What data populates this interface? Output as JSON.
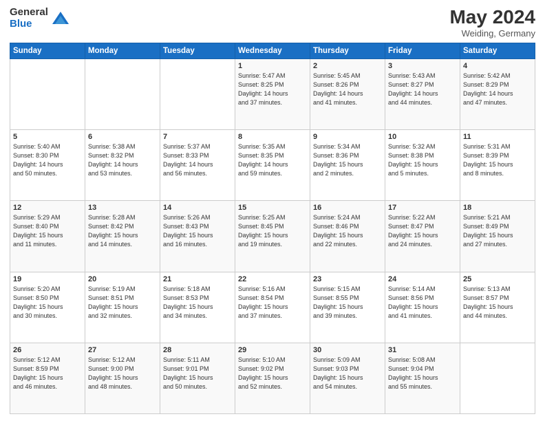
{
  "header": {
    "logo_general": "General",
    "logo_blue": "Blue",
    "month_year": "May 2024",
    "location": "Weiding, Germany"
  },
  "weekdays": [
    "Sunday",
    "Monday",
    "Tuesday",
    "Wednesday",
    "Thursday",
    "Friday",
    "Saturday"
  ],
  "weeks": [
    [
      {
        "day": "",
        "info": ""
      },
      {
        "day": "",
        "info": ""
      },
      {
        "day": "",
        "info": ""
      },
      {
        "day": "1",
        "info": "Sunrise: 5:47 AM\nSunset: 8:25 PM\nDaylight: 14 hours\nand 37 minutes."
      },
      {
        "day": "2",
        "info": "Sunrise: 5:45 AM\nSunset: 8:26 PM\nDaylight: 14 hours\nand 41 minutes."
      },
      {
        "day": "3",
        "info": "Sunrise: 5:43 AM\nSunset: 8:27 PM\nDaylight: 14 hours\nand 44 minutes."
      },
      {
        "day": "4",
        "info": "Sunrise: 5:42 AM\nSunset: 8:29 PM\nDaylight: 14 hours\nand 47 minutes."
      }
    ],
    [
      {
        "day": "5",
        "info": "Sunrise: 5:40 AM\nSunset: 8:30 PM\nDaylight: 14 hours\nand 50 minutes."
      },
      {
        "day": "6",
        "info": "Sunrise: 5:38 AM\nSunset: 8:32 PM\nDaylight: 14 hours\nand 53 minutes."
      },
      {
        "day": "7",
        "info": "Sunrise: 5:37 AM\nSunset: 8:33 PM\nDaylight: 14 hours\nand 56 minutes."
      },
      {
        "day": "8",
        "info": "Sunrise: 5:35 AM\nSunset: 8:35 PM\nDaylight: 14 hours\nand 59 minutes."
      },
      {
        "day": "9",
        "info": "Sunrise: 5:34 AM\nSunset: 8:36 PM\nDaylight: 15 hours\nand 2 minutes."
      },
      {
        "day": "10",
        "info": "Sunrise: 5:32 AM\nSunset: 8:38 PM\nDaylight: 15 hours\nand 5 minutes."
      },
      {
        "day": "11",
        "info": "Sunrise: 5:31 AM\nSunset: 8:39 PM\nDaylight: 15 hours\nand 8 minutes."
      }
    ],
    [
      {
        "day": "12",
        "info": "Sunrise: 5:29 AM\nSunset: 8:40 PM\nDaylight: 15 hours\nand 11 minutes."
      },
      {
        "day": "13",
        "info": "Sunrise: 5:28 AM\nSunset: 8:42 PM\nDaylight: 15 hours\nand 14 minutes."
      },
      {
        "day": "14",
        "info": "Sunrise: 5:26 AM\nSunset: 8:43 PM\nDaylight: 15 hours\nand 16 minutes."
      },
      {
        "day": "15",
        "info": "Sunrise: 5:25 AM\nSunset: 8:45 PM\nDaylight: 15 hours\nand 19 minutes."
      },
      {
        "day": "16",
        "info": "Sunrise: 5:24 AM\nSunset: 8:46 PM\nDaylight: 15 hours\nand 22 minutes."
      },
      {
        "day": "17",
        "info": "Sunrise: 5:22 AM\nSunset: 8:47 PM\nDaylight: 15 hours\nand 24 minutes."
      },
      {
        "day": "18",
        "info": "Sunrise: 5:21 AM\nSunset: 8:49 PM\nDaylight: 15 hours\nand 27 minutes."
      }
    ],
    [
      {
        "day": "19",
        "info": "Sunrise: 5:20 AM\nSunset: 8:50 PM\nDaylight: 15 hours\nand 30 minutes."
      },
      {
        "day": "20",
        "info": "Sunrise: 5:19 AM\nSunset: 8:51 PM\nDaylight: 15 hours\nand 32 minutes."
      },
      {
        "day": "21",
        "info": "Sunrise: 5:18 AM\nSunset: 8:53 PM\nDaylight: 15 hours\nand 34 minutes."
      },
      {
        "day": "22",
        "info": "Sunrise: 5:16 AM\nSunset: 8:54 PM\nDaylight: 15 hours\nand 37 minutes."
      },
      {
        "day": "23",
        "info": "Sunrise: 5:15 AM\nSunset: 8:55 PM\nDaylight: 15 hours\nand 39 minutes."
      },
      {
        "day": "24",
        "info": "Sunrise: 5:14 AM\nSunset: 8:56 PM\nDaylight: 15 hours\nand 41 minutes."
      },
      {
        "day": "25",
        "info": "Sunrise: 5:13 AM\nSunset: 8:57 PM\nDaylight: 15 hours\nand 44 minutes."
      }
    ],
    [
      {
        "day": "26",
        "info": "Sunrise: 5:12 AM\nSunset: 8:59 PM\nDaylight: 15 hours\nand 46 minutes."
      },
      {
        "day": "27",
        "info": "Sunrise: 5:12 AM\nSunset: 9:00 PM\nDaylight: 15 hours\nand 48 minutes."
      },
      {
        "day": "28",
        "info": "Sunrise: 5:11 AM\nSunset: 9:01 PM\nDaylight: 15 hours\nand 50 minutes."
      },
      {
        "day": "29",
        "info": "Sunrise: 5:10 AM\nSunset: 9:02 PM\nDaylight: 15 hours\nand 52 minutes."
      },
      {
        "day": "30",
        "info": "Sunrise: 5:09 AM\nSunset: 9:03 PM\nDaylight: 15 hours\nand 54 minutes."
      },
      {
        "day": "31",
        "info": "Sunrise: 5:08 AM\nSunset: 9:04 PM\nDaylight: 15 hours\nand 55 minutes."
      },
      {
        "day": "",
        "info": ""
      }
    ]
  ]
}
